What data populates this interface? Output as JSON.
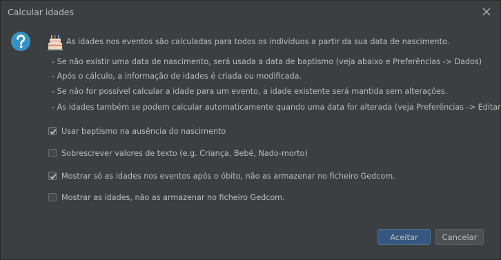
{
  "window": {
    "title": "Calcular idades"
  },
  "content": {
    "intro": "As idades nos eventos são calculadas para todos os indivíduos a partir da sua data de nascimento.",
    "bullets": [
      "- Se não existir uma data de nascimento, será usada a data de baptismo (veja abaixo e Preferências -> Dados)",
      "- Após o cálculo, a informação de idades é criada ou modificada.",
      "- Se não for possível calcular a idade para um evento, a idade existente será mantida sem alterações.",
      "- As idades também se podem calcular automaticamente quando uma data for alterada (veja Preferências -> Editar)"
    ]
  },
  "options": [
    {
      "label": "Usar baptismo na ausência do nascimento",
      "checked": true
    },
    {
      "label": "Sobrescrever valores de texto (e.g. Criança, Bebé, Nado-morto)",
      "checked": false
    },
    {
      "label": "Mostrar só as idades nos eventos após o óbito, não as armazenar no ficheiro Gedcom.",
      "checked": true
    },
    {
      "label": "Mostrar as idades, não as armazenar no ficheiro Gedcom.",
      "checked": false
    }
  ],
  "buttons": {
    "ok": "Aceitar",
    "cancel": "Cancelar"
  },
  "icons": {
    "close": "close-icon",
    "help": "question-icon",
    "cake": "birthday-cake-icon"
  },
  "colors": {
    "background": "#3c3f41",
    "text": "#bbbbbb",
    "help_icon": "#3592c4",
    "primary_button": "#365880"
  }
}
